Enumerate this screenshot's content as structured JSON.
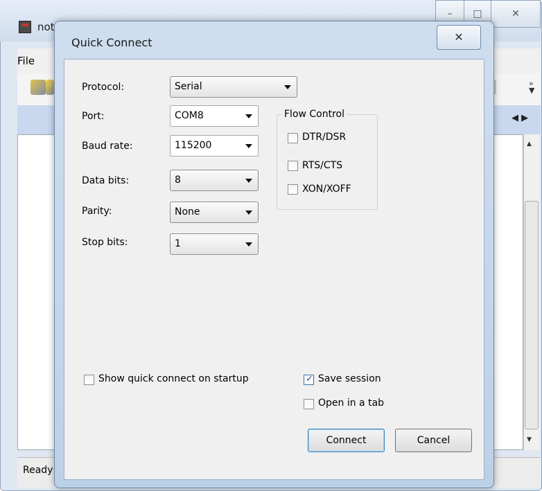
{
  "main_window": {
    "title": "not",
    "menu": {
      "file": "File"
    },
    "capbtn": {
      "min": "–",
      "max": "□",
      "close": "✕"
    },
    "tab_arrows": "◀ ▶",
    "status": "Ready"
  },
  "dialog": {
    "title": "Quick Connect",
    "close_glyph": "✕",
    "fields": {
      "protocol": {
        "label": "Protocol:",
        "value": "Serial"
      },
      "port": {
        "label": "Port:",
        "value": "COM8"
      },
      "baud": {
        "label": "Baud rate:",
        "value": "115200"
      },
      "data_bits": {
        "label": "Data bits:",
        "value": "8"
      },
      "parity": {
        "label": "Parity:",
        "value": "None"
      },
      "stop_bits": {
        "label": "Stop bits:",
        "value": "1"
      }
    },
    "flow_control": {
      "legend": "Flow Control",
      "dtr_dsr": {
        "label": "DTR/DSR",
        "checked": false
      },
      "rts_cts": {
        "label": "RTS/CTS",
        "checked": false
      },
      "xon_xoff": {
        "label": "XON/XOFF",
        "checked": false
      }
    },
    "options": {
      "show_on_startup": {
        "label": "Show quick connect on startup",
        "checked": false
      },
      "save_session": {
        "label": "Save session",
        "checked": true
      },
      "open_in_tab": {
        "label": "Open in a tab",
        "checked": false
      }
    },
    "buttons": {
      "connect": "Connect",
      "cancel": "Cancel"
    }
  }
}
